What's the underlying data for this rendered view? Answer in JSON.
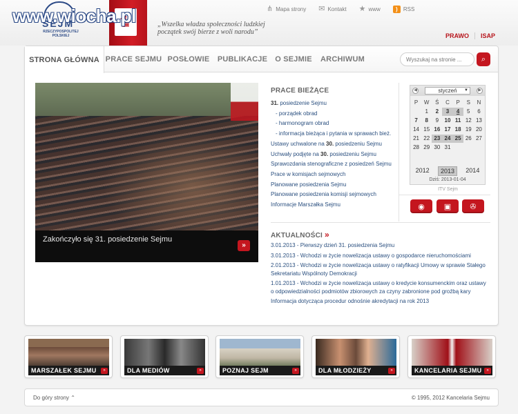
{
  "watermark": "www.wiocha.pl",
  "logo": {
    "title": "SEJM",
    "subtitle": "RZECZYPOSPOLITEJ POLSKIEJ"
  },
  "motto": "„Wszelka władza społeczności ludzkiej początek swój bierze z woli narodu”",
  "top_links": [
    {
      "label": "Mapa strony",
      "icon": "sitemap-icon"
    },
    {
      "label": "Kontakt",
      "icon": "mail-icon"
    },
    {
      "label": "www",
      "icon": "star-icon"
    },
    {
      "label": "RSS",
      "icon": "rss-icon"
    }
  ],
  "header_links": [
    "PRAWO",
    "ISAP"
  ],
  "nav": [
    "STRONA GŁÓWNA",
    "PRACE SEJMU",
    "POSŁOWIE",
    "PUBLIKACJE",
    "O SEJMIE",
    "ARCHIWUM"
  ],
  "search": {
    "placeholder": "Wyszukaj na stronie ..."
  },
  "photo": {
    "caption": "Zakończyło się 31. posiedzenie Sejmu"
  },
  "prace": {
    "title": "PRACE BIEŻĄCE",
    "items": [
      {
        "strong": "31.",
        "text": " posiedzenie Sejmu"
      },
      {
        "text": "- porządek obrad"
      },
      {
        "text": "- harmonogram obrad"
      },
      {
        "text": "- informacja bieżąca i pytania w sprawach bież."
      },
      {
        "pre": "Ustawy uchwalone na ",
        "strong": "30.",
        "text": " posiedzeniu Sejmu"
      },
      {
        "pre": "Uchwały podjęte na ",
        "strong": "30.",
        "text": " posiedzeniu Sejmu"
      },
      {
        "text": "Sprawozdania stenograficzne z posiedzeń Sejmu"
      },
      {
        "text": "Prace w komisjach sejmowych"
      },
      {
        "text": "Planowane posiedzenia Sejmu"
      },
      {
        "text": "Planowane posiedzenia komisji sejmowych"
      },
      {
        "text": "Informacje Marszałka Sejmu"
      }
    ]
  },
  "calendar": {
    "month": "styczeń",
    "weekdays": [
      "P",
      "W",
      "Ś",
      "C",
      "P",
      "S",
      "N"
    ],
    "days": [
      {
        "d": ""
      },
      {
        "d": "1"
      },
      {
        "d": "2",
        "b": true
      },
      {
        "d": "3",
        "b": true,
        "h": true
      },
      {
        "d": "4",
        "today": true
      },
      {
        "d": "5"
      },
      {
        "d": "6"
      },
      {
        "d": "7",
        "b": true
      },
      {
        "d": "8",
        "b": true
      },
      {
        "d": "9"
      },
      {
        "d": "10",
        "b": true
      },
      {
        "d": "11",
        "b": true
      },
      {
        "d": "12"
      },
      {
        "d": "13"
      },
      {
        "d": "14"
      },
      {
        "d": "15"
      },
      {
        "d": "16",
        "b": true
      },
      {
        "d": "17",
        "b": true
      },
      {
        "d": "18",
        "b": true
      },
      {
        "d": "19"
      },
      {
        "d": "20"
      },
      {
        "d": "21"
      },
      {
        "d": "22"
      },
      {
        "d": "23",
        "b": true,
        "h": true
      },
      {
        "d": "24",
        "b": true,
        "h": true
      },
      {
        "d": "25",
        "b": true,
        "h": true
      },
      {
        "d": "26"
      },
      {
        "d": "27"
      },
      {
        "d": "28"
      },
      {
        "d": "29"
      },
      {
        "d": "30"
      },
      {
        "d": "31"
      },
      {
        "d": ""
      },
      {
        "d": ""
      },
      {
        "d": ""
      }
    ],
    "years": [
      "2012",
      "2013",
      "2014"
    ],
    "active_year": "2013",
    "today_label": "Dziś: 2013-01-04"
  },
  "itv": {
    "label": "ITV Sejm",
    "buttons": [
      "radio-icon",
      "tv-icon",
      "film-icon"
    ]
  },
  "news": {
    "title": "AKTUALNOŚCI",
    "items": [
      "3.01.2013 - Pierwszy dzień 31. posiedzenia Sejmu",
      "3.01.2013 - Wchodzi w życie nowelizacja ustawy o gospodarce nieruchomościami",
      "2.01.2013 - Wchodzi w życie nowelizacja ustawy o ratyfikacji Umowy w sprawie Stałego Sekretariatu Wspólnoty Demokracji",
      "1.01.2013 - Wchodzi w życie nowelizacja ustawy o kredycie konsumenckim oraz ustawy o odpowiedzialności podmiotów zbiorowych za czyny zabronione pod groźbą kary",
      "Informacja dotycząca procedur odnośnie akredytacji na rok 2013"
    ]
  },
  "tiles": [
    {
      "label": "MARSZAŁEK SEJMU"
    },
    {
      "label": "DLA MEDIÓW"
    },
    {
      "label": "POZNAJ SEJM"
    },
    {
      "label": "DLA MŁODZIEŻY"
    },
    {
      "label": "KANCELARIA SEJMU"
    }
  ],
  "footer": {
    "left": "Do góry strony",
    "right": "© 1995, 2012  Kancelaria Sejmu"
  },
  "colors": {
    "accent": "#c4161f",
    "link": "#2a4f7f",
    "brand_blue": "#2c4a86"
  }
}
